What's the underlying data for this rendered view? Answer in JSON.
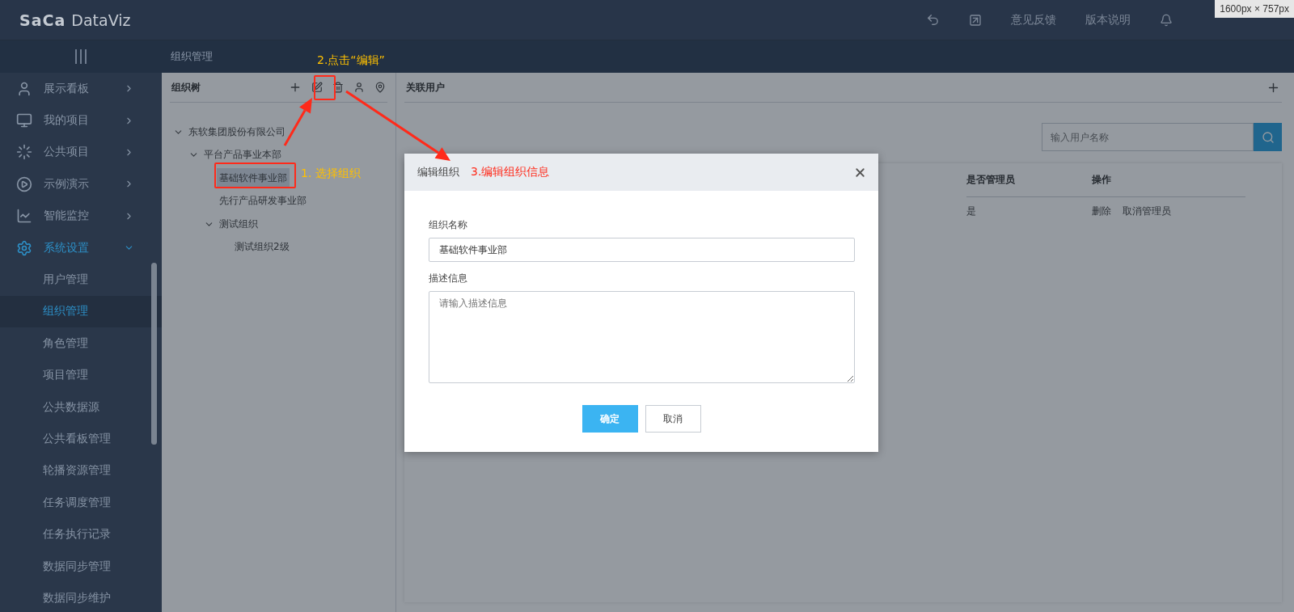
{
  "top_bar": {
    "logo": {
      "brand": "SaCa",
      "product": "DataViz"
    },
    "links": [
      "意见反馈",
      "版本说明"
    ],
    "size_badge": "1600px × 757px"
  },
  "breadcrumb": "组织管理",
  "sidebar": {
    "items": [
      {
        "label": "展示看板",
        "selected": false,
        "expanded": false
      },
      {
        "label": "我的项目",
        "selected": false,
        "expanded": false
      },
      {
        "label": "公共项目",
        "selected": false,
        "expanded": false
      },
      {
        "label": "示例演示",
        "selected": false,
        "expanded": false
      },
      {
        "label": "智能监控",
        "selected": false,
        "expanded": false
      },
      {
        "label": "系统设置",
        "selected": true,
        "expanded": true,
        "children": [
          {
            "label": "用户管理",
            "selected": false
          },
          {
            "label": "组织管理",
            "selected": true
          },
          {
            "label": "角色管理",
            "selected": false
          },
          {
            "label": "项目管理",
            "selected": false
          },
          {
            "label": "公共数据源",
            "selected": false
          },
          {
            "label": "公共看板管理",
            "selected": false
          },
          {
            "label": "轮播资源管理",
            "selected": false
          },
          {
            "label": "任务调度管理",
            "selected": false
          },
          {
            "label": "任务执行记录",
            "selected": false
          },
          {
            "label": "数据同步管理",
            "selected": false
          },
          {
            "label": "数据同步维护",
            "selected": false
          }
        ]
      }
    ]
  },
  "org_tree": {
    "title": "组织树",
    "nodes": [
      {
        "label": "东软集团股份有限公司",
        "expanded": true,
        "selected": false,
        "children": [
          {
            "label": "平台产品事业本部",
            "expanded": true,
            "selected": false,
            "children": [
              {
                "label": "基础软件事业部",
                "selected": true
              },
              {
                "label": "先行产品研发事业部",
                "selected": false
              },
              {
                "label": "测试组织",
                "expanded": true,
                "selected": false,
                "children": [
                  {
                    "label": "测试组织2级",
                    "selected": false
                  }
                ]
              }
            ]
          }
        ]
      }
    ]
  },
  "users_panel": {
    "title": "关联用户",
    "search": {
      "placeholder": "输入用户名称"
    },
    "table": {
      "columns": [
        "是否管理员",
        "操作"
      ],
      "rows": [
        {
          "cells": [
            "是"
          ],
          "actions": [
            "删除",
            "取消管理员"
          ]
        }
      ]
    }
  },
  "dialog": {
    "title": "编辑组织",
    "fields": [
      {
        "kind": "input",
        "label": "组织名称",
        "value": "基础软件事业部"
      },
      {
        "kind": "textarea",
        "label": "描述信息",
        "placeholder": "请输入描述信息"
      }
    ],
    "buttons": [
      {
        "label": "确定",
        "kind": "primary"
      },
      {
        "label": "取消",
        "kind": "default"
      }
    ]
  },
  "annotations": {
    "step1": "1. 选择组织",
    "step2": "2.点击“编辑”",
    "step3": "3.编辑组织信息"
  }
}
